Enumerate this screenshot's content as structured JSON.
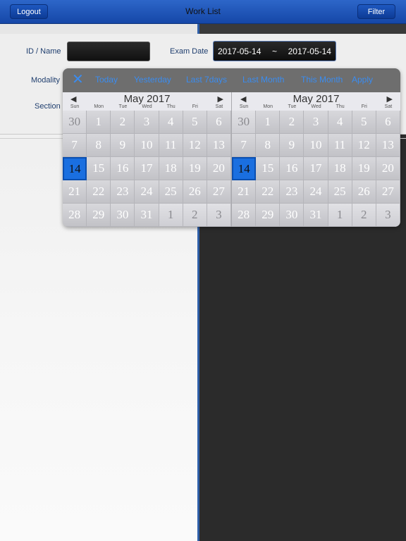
{
  "navbar": {
    "title": "Work List",
    "logout_label": "Logout",
    "filter_label": "Filter"
  },
  "filter": {
    "id_label": "ID / Name",
    "id_value": "",
    "exam_date_label": "Exam Date",
    "date_from": "2017-05-14",
    "date_sep": "~",
    "date_to": "2017-05-14",
    "modality_label": "Modality",
    "section_label": "Section"
  },
  "calendar": {
    "toolbar": {
      "today": "Today",
      "yesterday": "Yesterday",
      "last7": "Last 7days",
      "last_month": "Last Month",
      "this_month": "This Month",
      "apply": "Apply"
    },
    "dow": [
      "Sun",
      "Mon",
      "Tue",
      "Wed",
      "Thu",
      "Fri",
      "Sat"
    ],
    "months": [
      {
        "title": "May 2017",
        "days": [
          {
            "d": "30",
            "o": true
          },
          {
            "d": "1",
            "o": false
          },
          {
            "d": "2",
            "o": false
          },
          {
            "d": "3",
            "o": false
          },
          {
            "d": "4",
            "o": false
          },
          {
            "d": "5",
            "o": false
          },
          {
            "d": "6",
            "o": false
          },
          {
            "d": "7",
            "o": false
          },
          {
            "d": "8",
            "o": false
          },
          {
            "d": "9",
            "o": false
          },
          {
            "d": "10",
            "o": false
          },
          {
            "d": "11",
            "o": false
          },
          {
            "d": "12",
            "o": false
          },
          {
            "d": "13",
            "o": false
          },
          {
            "d": "14",
            "o": false,
            "s": true
          },
          {
            "d": "15",
            "o": false
          },
          {
            "d": "16",
            "o": false
          },
          {
            "d": "17",
            "o": false
          },
          {
            "d": "18",
            "o": false
          },
          {
            "d": "19",
            "o": false
          },
          {
            "d": "20",
            "o": false
          },
          {
            "d": "21",
            "o": false
          },
          {
            "d": "22",
            "o": false
          },
          {
            "d": "23",
            "o": false
          },
          {
            "d": "24",
            "o": false
          },
          {
            "d": "25",
            "o": false
          },
          {
            "d": "26",
            "o": false
          },
          {
            "d": "27",
            "o": false
          },
          {
            "d": "28",
            "o": false
          },
          {
            "d": "29",
            "o": false
          },
          {
            "d": "30",
            "o": false
          },
          {
            "d": "31",
            "o": false
          },
          {
            "d": "1",
            "o": true
          },
          {
            "d": "2",
            "o": true
          },
          {
            "d": "3",
            "o": true
          }
        ]
      },
      {
        "title": "May 2017",
        "days": [
          {
            "d": "30",
            "o": true
          },
          {
            "d": "1",
            "o": false
          },
          {
            "d": "2",
            "o": false
          },
          {
            "d": "3",
            "o": false
          },
          {
            "d": "4",
            "o": false
          },
          {
            "d": "5",
            "o": false
          },
          {
            "d": "6",
            "o": false
          },
          {
            "d": "7",
            "o": false
          },
          {
            "d": "8",
            "o": false
          },
          {
            "d": "9",
            "o": false
          },
          {
            "d": "10",
            "o": false
          },
          {
            "d": "11",
            "o": false
          },
          {
            "d": "12",
            "o": false
          },
          {
            "d": "13",
            "o": false
          },
          {
            "d": "14",
            "o": false,
            "s": true
          },
          {
            "d": "15",
            "o": false
          },
          {
            "d": "16",
            "o": false
          },
          {
            "d": "17",
            "o": false
          },
          {
            "d": "18",
            "o": false
          },
          {
            "d": "19",
            "o": false
          },
          {
            "d": "20",
            "o": false
          },
          {
            "d": "21",
            "o": false
          },
          {
            "d": "22",
            "o": false
          },
          {
            "d": "23",
            "o": false
          },
          {
            "d": "24",
            "o": false
          },
          {
            "d": "25",
            "o": false
          },
          {
            "d": "26",
            "o": false
          },
          {
            "d": "27",
            "o": false
          },
          {
            "d": "28",
            "o": false
          },
          {
            "d": "29",
            "o": false
          },
          {
            "d": "30",
            "o": false
          },
          {
            "d": "31",
            "o": false
          },
          {
            "d": "1",
            "o": true
          },
          {
            "d": "2",
            "o": true
          },
          {
            "d": "3",
            "o": true
          }
        ]
      }
    ],
    "icons": {
      "close": "close-icon",
      "prev": "chevron-left-icon",
      "next": "chevron-right-icon"
    }
  },
  "colors": {
    "accent": "#3a8cf0",
    "selected": "#1a6fe0",
    "navbar": "#1e56b8"
  }
}
